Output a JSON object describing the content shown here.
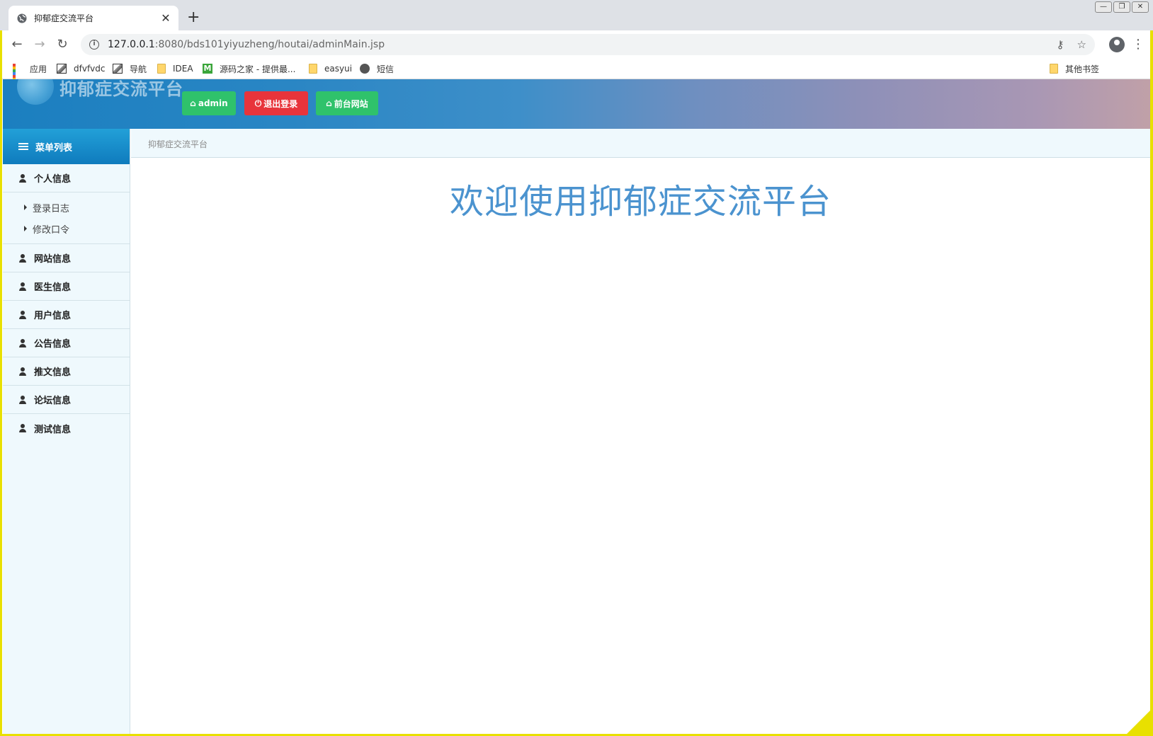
{
  "browser": {
    "tab_title": "抑郁症交流平台",
    "url_host": "127.0.0.1",
    "url_rest": ":8080/bds101yiyuzheng/houtai/adminMain.jsp",
    "new_tab": "+",
    "tab_close": "✕"
  },
  "bookmarks": {
    "items": [
      {
        "label": "应用",
        "icon": "apps-icon"
      },
      {
        "label": "dfvfvdc",
        "icon": "image-icon"
      },
      {
        "label": "导航",
        "icon": "image-icon"
      },
      {
        "label": "IDEA",
        "icon": "folder-icon"
      },
      {
        "label": "源码之家 - 提供最...",
        "icon": "m-icon"
      },
      {
        "label": "easyui",
        "icon": "folder-icon"
      },
      {
        "label": "短信",
        "icon": "globe-icon"
      }
    ],
    "other": "其他书签"
  },
  "header": {
    "logo_text": "抑郁症交流平台",
    "buttons": {
      "admin": "admin",
      "logout": "退出登录",
      "frontend": "前台网站"
    },
    "colors": {
      "green": "#2fc26b",
      "red": "#e8343b"
    }
  },
  "sidebar": {
    "title": "菜单列表",
    "personal": "个人信息",
    "sub_items": [
      "登录日志",
      "修改口令"
    ],
    "items": [
      "网站信息",
      "医生信息",
      "用户信息",
      "公告信息",
      "推文信息",
      "论坛信息",
      "测试信息"
    ]
  },
  "main": {
    "breadcrumb": "抑郁症交流平台",
    "welcome": "欢迎使用抑郁症交流平台",
    "welcome_color": "#4b93cf"
  }
}
